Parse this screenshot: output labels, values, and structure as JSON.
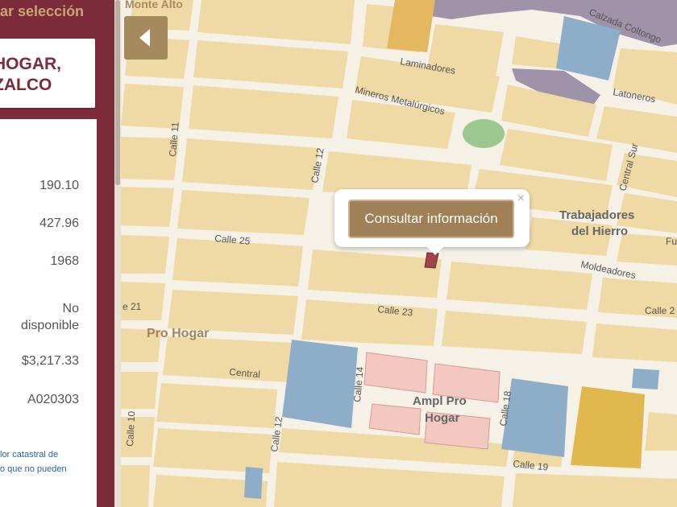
{
  "sidebar": {
    "clear_selection": "tar selección",
    "title_line1": "HOGAR,",
    "title_line2": "ZALCO",
    "values": [
      "190.10",
      "427.96",
      "1968",
      "No",
      "disponible",
      "$3,217.33",
      "A020303"
    ],
    "footnote_line1": "lor catastral de",
    "footnote_line2": "o que no pueden"
  },
  "popup": {
    "button_label": "Consultar información",
    "close_symbol": "×"
  },
  "map": {
    "labels": {
      "monte_alto": "Monte Alto",
      "calzada_coltongo": "Calzada Coltongo",
      "laminadores": "Laminadores",
      "mineros": "Mineros Metalúrgicos",
      "latoneros": "Latoneros",
      "calle11": "Calle 11",
      "calle12_top": "Calle 12",
      "calle25": "Calle 25",
      "trab1": "Trabajadores",
      "trab2": "del Hierro",
      "central_sur": "Central Sur",
      "fu": "Fu",
      "moldeadores": "Moldeadores",
      "calle21": "e 21",
      "calle23": "Calle 23",
      "calle2x": "Calle 2",
      "pro_hogar": "Pro Hogar",
      "central": "Central",
      "calle14": "Calle 14",
      "ampl1": "Ampl Pro",
      "ampl2": "Hogar",
      "calle18": "Calle 18",
      "calle10": "Calle 10",
      "calle12_bottom": "Calle 12",
      "calle19": "Calle 19"
    },
    "colors": {
      "block": "#efd9a4",
      "street": "#ffffff",
      "industrial": "#9f93aa",
      "water": "#8eadc9",
      "commercial": "#e4b760",
      "park": "#9cc78f",
      "parcel": "#f3c8c0",
      "selected": "#a0434a"
    }
  }
}
